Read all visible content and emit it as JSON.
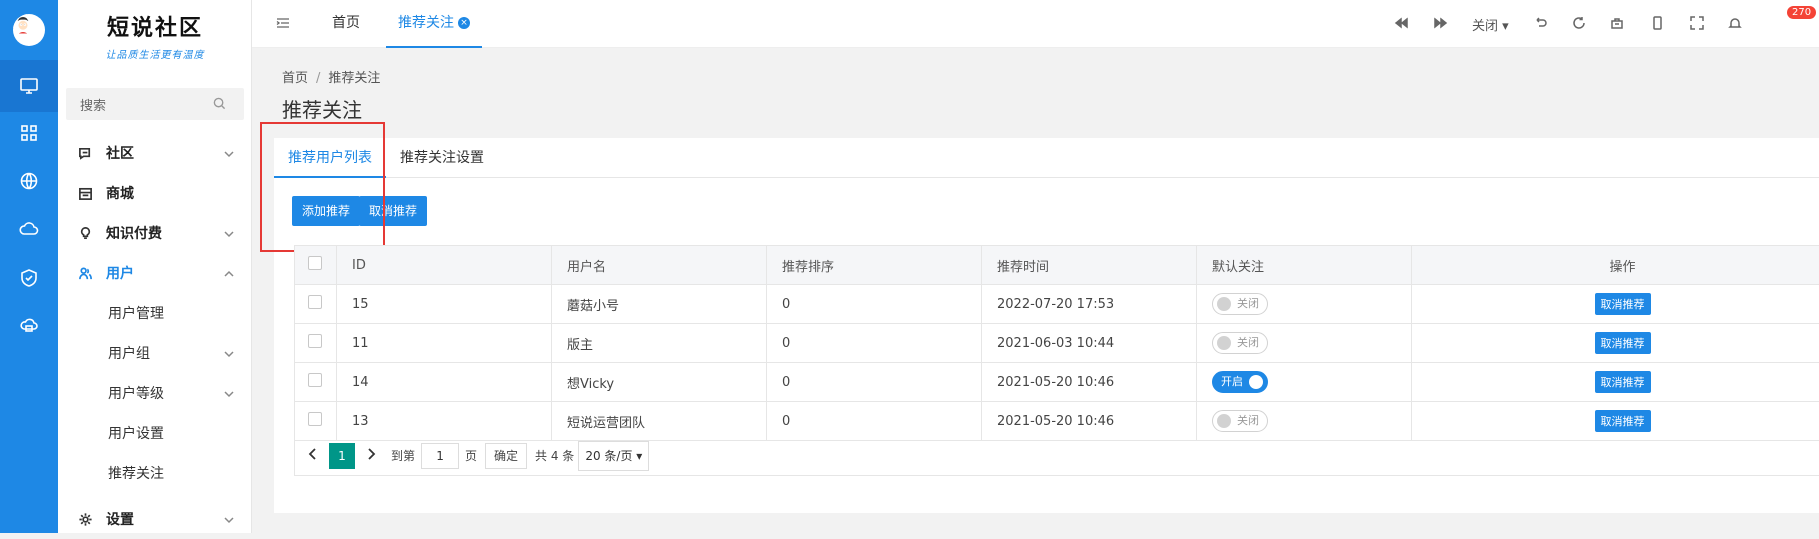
{
  "sidebar": {
    "logo_title": "短说社区",
    "logo_sub": "让品质生活更有温度",
    "search_placeholder": "搜索",
    "menu": [
      {
        "label": "社区"
      },
      {
        "label": "商城"
      },
      {
        "label": "知识付费"
      },
      {
        "label": "用户"
      }
    ],
    "user_sub": [
      "用户管理",
      "用户组",
      "用户等级",
      "用户设置",
      "推荐关注"
    ],
    "settings": "设置"
  },
  "topbar": {
    "tab_home": "首页",
    "tab_current": "推荐关注",
    "close_label": "关闭",
    "badge": "270"
  },
  "page": {
    "crumb_home": "首页",
    "crumb_sep": "/",
    "crumb_current": "推荐关注",
    "title": "推荐关注",
    "tab_list": "推荐用户列表",
    "tab_settings": "推荐关注设置",
    "btn_add": "添加推荐",
    "btn_cancel": "取消推荐"
  },
  "table": {
    "headers": [
      "ID",
      "用户名",
      "推荐排序",
      "推荐时间",
      "默认关注",
      "操作"
    ],
    "rows": [
      {
        "id": "15",
        "name": "蘑菇小号",
        "order": "0",
        "time": "2022-07-20 17:53",
        "follow": "关闭",
        "on": false,
        "action": "取消推荐"
      },
      {
        "id": "11",
        "name": "版主",
        "order": "0",
        "time": "2021-06-03 10:44",
        "follow": "关闭",
        "on": false,
        "action": "取消推荐"
      },
      {
        "id": "14",
        "name": "想Vicky",
        "order": "0",
        "time": "2021-05-20 10:46",
        "follow": "开启",
        "on": true,
        "action": "取消推荐"
      },
      {
        "id": "13",
        "name": "短说运营团队",
        "order": "0",
        "time": "2021-05-20 10:46",
        "follow": "关闭",
        "on": false,
        "action": "取消推荐"
      }
    ]
  },
  "pager": {
    "page": "1",
    "goto": "到第",
    "goto_value": "1",
    "page_unit": "页",
    "confirm": "确定",
    "total": "共 4 条",
    "per_page": "20 条/页"
  },
  "colors": {
    "accent": "#1e88e5",
    "pager_active": "#009688",
    "highlight": "#e53935"
  }
}
